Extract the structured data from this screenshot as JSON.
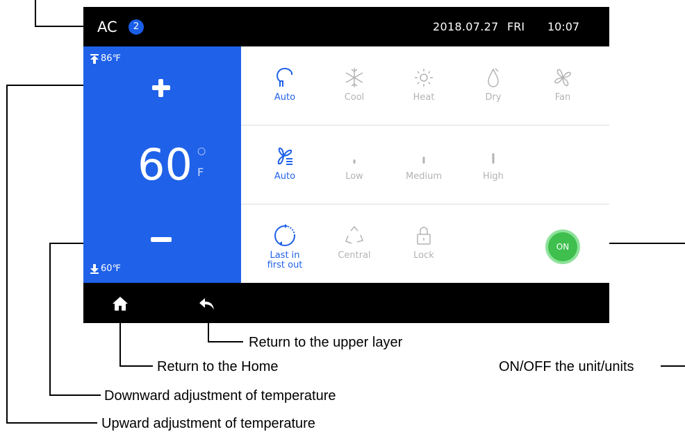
{
  "device": {
    "status_bar": {
      "title": "AC",
      "badge": "2",
      "date": "2018.07.27",
      "weekday": "FRI",
      "time": "10:07"
    },
    "temperature": {
      "max_label": "86℉",
      "current": "60",
      "degree": "○",
      "unit": "F",
      "min_label": "60℉"
    },
    "mode_options": [
      {
        "label": "Auto",
        "icon": "auto-mode-icon",
        "active": true
      },
      {
        "label": "Cool",
        "icon": "snowflake-icon",
        "active": false
      },
      {
        "label": "Heat",
        "icon": "sun-icon",
        "active": false
      },
      {
        "label": "Dry",
        "icon": "droplet-icon",
        "active": false
      },
      {
        "label": "Fan",
        "icon": "fan-icon",
        "active": false
      }
    ],
    "fan_speed_options": [
      {
        "label": "Auto",
        "icon": "fan-speed-auto-icon",
        "active": true
      },
      {
        "label": "Low",
        "icon": "speed-low-icon",
        "active": false
      },
      {
        "label": "Medium",
        "icon": "speed-medium-icon",
        "active": false
      },
      {
        "label": "High",
        "icon": "speed-high-icon",
        "active": false
      }
    ],
    "control_options": [
      {
        "label": "Last in\nfirst out",
        "icon": "last-in-first-out-icon",
        "active": true
      },
      {
        "label": "Central",
        "icon": "central-icon",
        "active": false
      },
      {
        "label": "Lock",
        "icon": "lock-icon",
        "active": false
      }
    ],
    "power_label": "ON",
    "nav": {
      "home_icon": "home-icon",
      "back_icon": "back-arrow-icon"
    }
  },
  "callouts": {
    "upper_layer": "Return to the upper layer",
    "home": "Return to the Home",
    "onoff": "ON/OFF the unit/units",
    "down": "Downward adjustment of temperature",
    "up": "Upward adjustment of temperature"
  },
  "colors": {
    "accent_blue": "#1f61e8",
    "badge_blue": "#1a5ee8",
    "power_green": "#3fbf4e",
    "inactive_gray": "#b3b3b3",
    "screen_black": "#000000"
  }
}
